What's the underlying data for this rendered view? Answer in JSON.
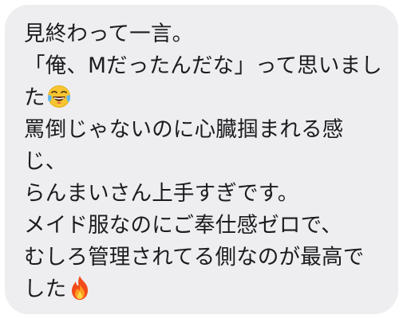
{
  "message": {
    "lines": [
      "見終わって一言。",
      "「俺、Mだったんだな」って思いまし",
      "た",
      "罵倒じゃないのに心臓掴まれる感",
      "じ、",
      "らんまいさん上手すぎです。",
      "メイド服なのにご奉仕感ゼロで、",
      "むしろ管理されてる側なのが最高で",
      "した"
    ],
    "emoji_line3": "laughing-with-tears-icon",
    "emoji_line9": "fire-icon"
  },
  "colors": {
    "bubble_background": "#eeeef0",
    "text": "#1c1c1e",
    "page_background": "#ffffff"
  }
}
